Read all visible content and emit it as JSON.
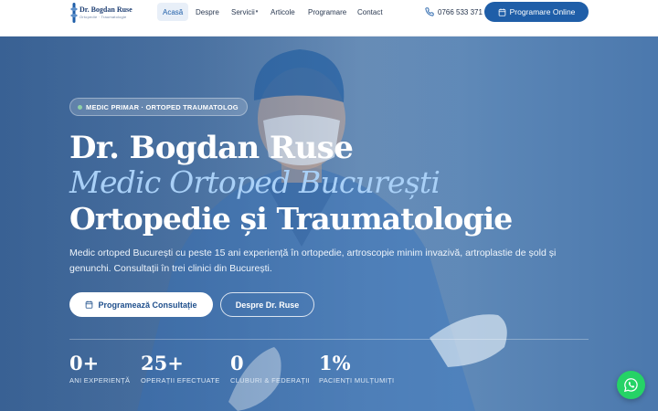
{
  "header": {
    "logo_name": "Dr. Bogdan Ruse",
    "logo_sub": "Ortopedie · Traumatologie",
    "nav": [
      {
        "label": "Acasă"
      },
      {
        "label": "Despre"
      },
      {
        "label": "Servicii",
        "caret": "▾"
      },
      {
        "label": "Articole"
      },
      {
        "label": "Programare"
      },
      {
        "label": "Contact"
      }
    ],
    "phone": "0766 533 371",
    "cta_label": "Programare Online"
  },
  "hero": {
    "badge": "MEDIC PRIMAR · ORTOPED TRAUMATOLOG",
    "title_line1": "Dr. Bogdan Ruse",
    "title_line2": "Medic Ortoped București",
    "title_line3": "Ortopedie și Traumatologie",
    "description": "Medic ortoped București cu peste 15 ani experiență în ortopedie, artroscopie minim invazivă, artroplastie de șold și genunchi. Consultații în trei clinici din București.",
    "primary_button": "Programează Consultație",
    "secondary_button": "Despre Dr. Ruse"
  },
  "stats": [
    {
      "value": "0+",
      "label": "ANI EXPERIENȚĂ"
    },
    {
      "value": "25+",
      "label": "OPERAȚII EFECTUATE"
    },
    {
      "value": "0",
      "label": "CLUBURI & FEDERAȚII"
    },
    {
      "value": "1%",
      "label": "PACIENȚI MULȚUMIȚI"
    }
  ],
  "icons": {
    "phone": "phone-icon",
    "calendar": "calendar-icon",
    "whatsapp": "whatsapp-icon"
  },
  "colors": {
    "brand": "#1f5ea8",
    "accent_title": "#a9d0f7",
    "whatsapp": "#25d366"
  }
}
